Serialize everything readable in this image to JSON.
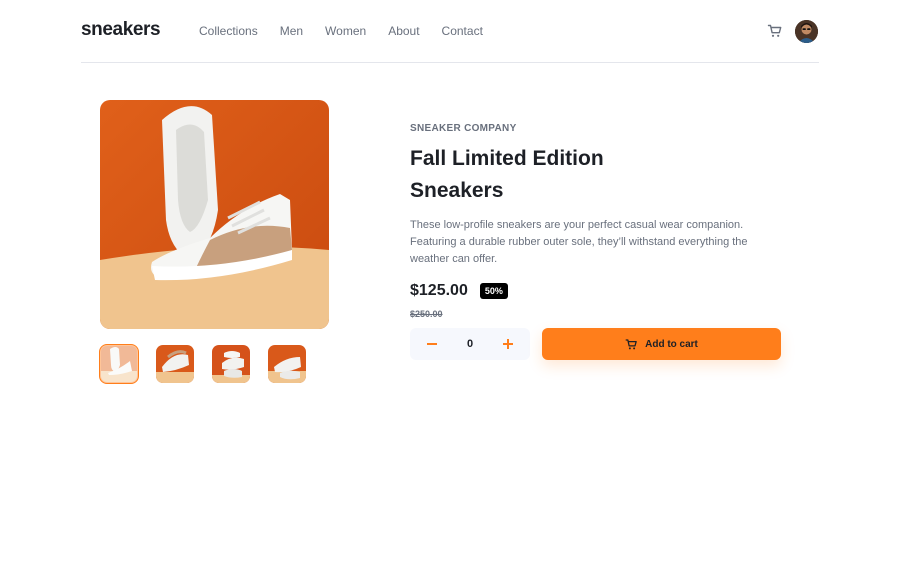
{
  "brand": {
    "logo": "sneakers"
  },
  "nav": {
    "items": [
      "Collections",
      "Men",
      "Women",
      "About",
      "Contact"
    ]
  },
  "product": {
    "company": "SNEAKER COMPANY",
    "title": "Fall Limited Edition Sneakers",
    "description": "These low-profile sneakers are your perfect casual wear companion. Featuring a durable rubber outer sole, they’ll withstand everything the weather can offer.",
    "price": "$125.00",
    "discount": "50%",
    "original_price": "$250.00"
  },
  "cart": {
    "quantity": "0",
    "minus_label": "−",
    "plus_label": "+",
    "add_label": "Add to cart"
  },
  "colors": {
    "accent": "#ff7e1b",
    "dark": "#1d2026",
    "muted": "#69707d",
    "background": "#f6f8fd"
  },
  "icons": {
    "cart": "cart-icon",
    "minus": "minus-icon",
    "plus": "plus-icon"
  }
}
